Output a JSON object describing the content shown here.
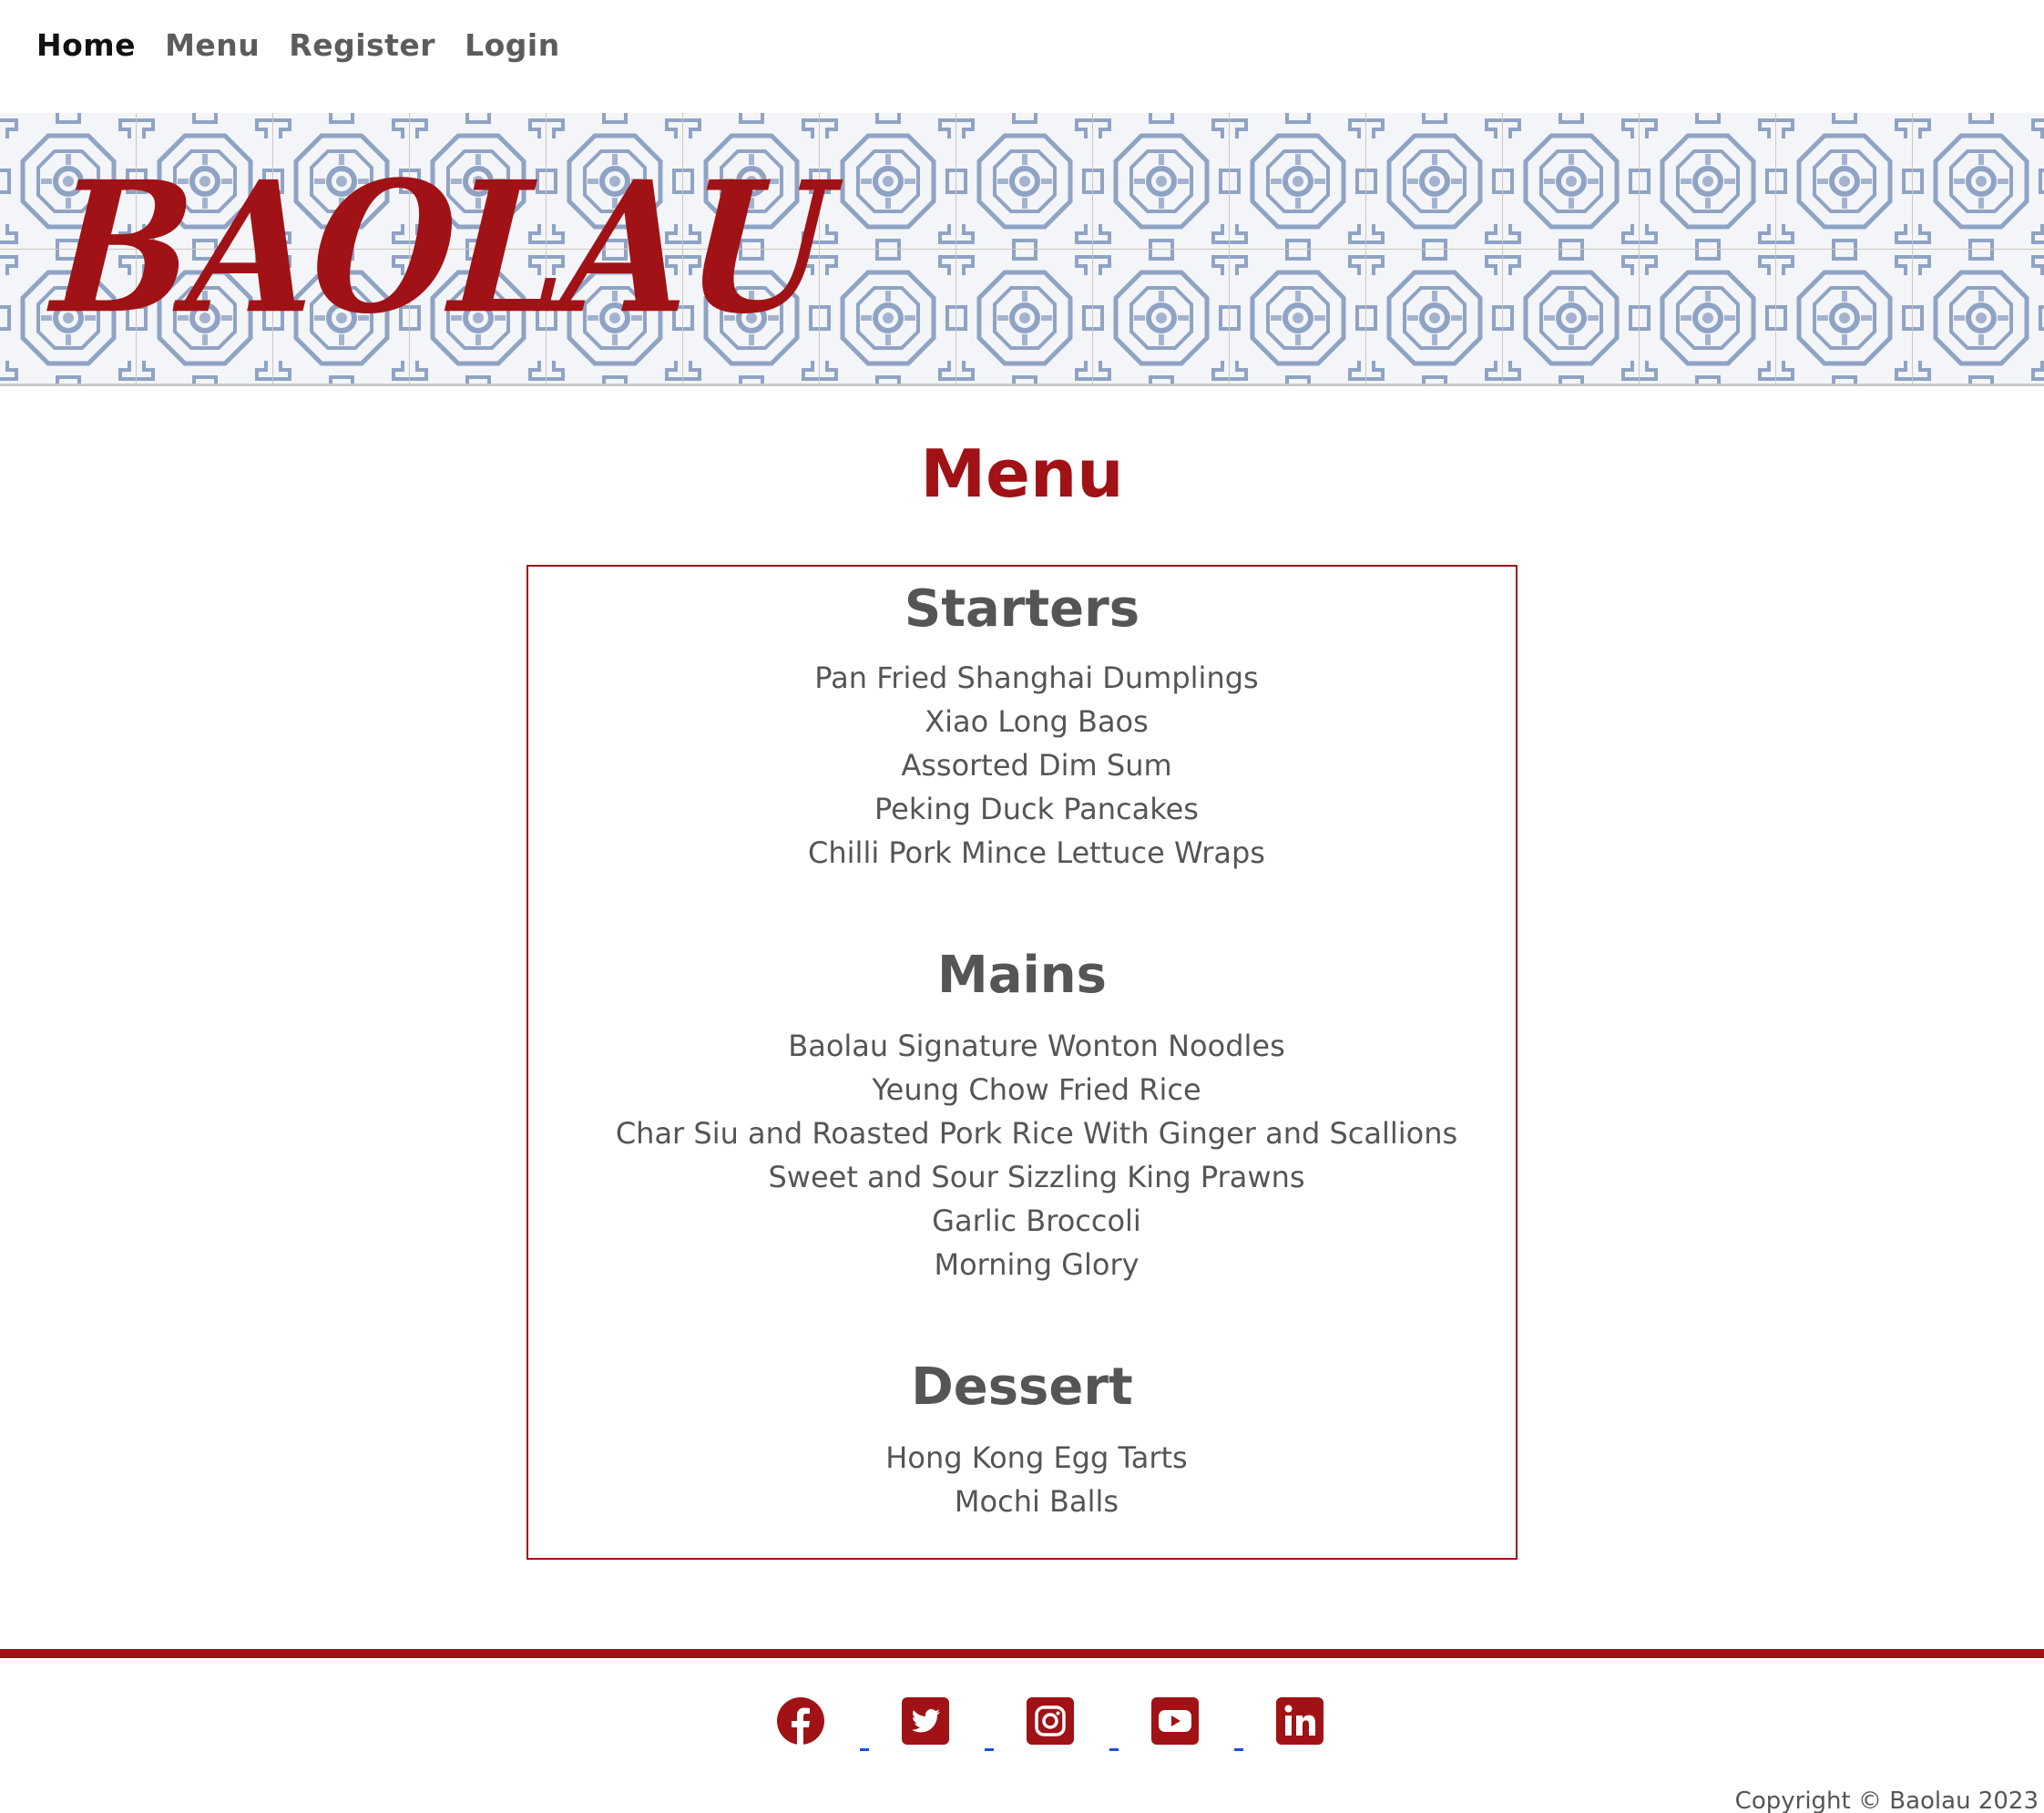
{
  "nav": {
    "items": [
      {
        "label": "Home",
        "active": true
      },
      {
        "label": "Menu",
        "active": false
      },
      {
        "label": "Register",
        "active": false
      },
      {
        "label": "Login",
        "active": false
      }
    ]
  },
  "banner": {
    "brand": "BAOLAU"
  },
  "page": {
    "title": "Menu"
  },
  "menu": {
    "sections": [
      {
        "title": "Starters",
        "items": [
          "Pan Fried Shanghai Dumplings",
          "Xiao Long Baos",
          "Assorted Dim Sum",
          "Peking Duck Pancakes",
          "Chilli Pork Mince Lettuce Wraps"
        ]
      },
      {
        "title": "Mains",
        "items": [
          "Baolau Signature Wonton Noodles",
          "Yeung Chow Fried Rice",
          "Char Siu and Roasted Pork Rice With Ginger and Scallions",
          "Sweet and Sour Sizzling King Prawns",
          "Garlic Broccoli",
          "Morning Glory"
        ]
      },
      {
        "title": "Dessert",
        "items": [
          "Hong Kong Egg Tarts",
          "Mochi Balls"
        ]
      }
    ]
  },
  "footer": {
    "social": [
      "facebook-icon",
      "twitter-icon",
      "instagram-icon",
      "youtube-icon",
      "linkedin-icon"
    ],
    "copyright": "Copyright © Baolau 2023"
  },
  "colors": {
    "brand_red": "#a01215",
    "text_grey": "#555555",
    "pattern_blue": "#8fa3c4"
  }
}
